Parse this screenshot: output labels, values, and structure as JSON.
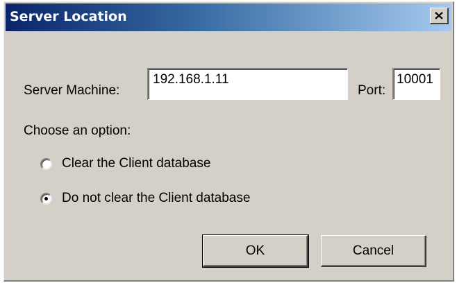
{
  "window": {
    "title": "Server Location"
  },
  "server": {
    "machine_label": "Server Machine:",
    "machine_value": "192.168.1.11",
    "port_label": "Port:",
    "port_value": "10001"
  },
  "options": {
    "prompt": "Choose an option:",
    "items": [
      {
        "label": "Clear the Client database",
        "selected": false
      },
      {
        "label": "Do not clear the Client database",
        "selected": true
      }
    ]
  },
  "buttons": {
    "ok_label": "OK",
    "cancel_label": "Cancel"
  },
  "icons": {
    "close": "close-icon",
    "radio": "radio-icon"
  },
  "colors": {
    "dialog_background": "#d4d0c8",
    "titlebar_start": "#0a246a",
    "titlebar_end": "#a6caf0"
  }
}
